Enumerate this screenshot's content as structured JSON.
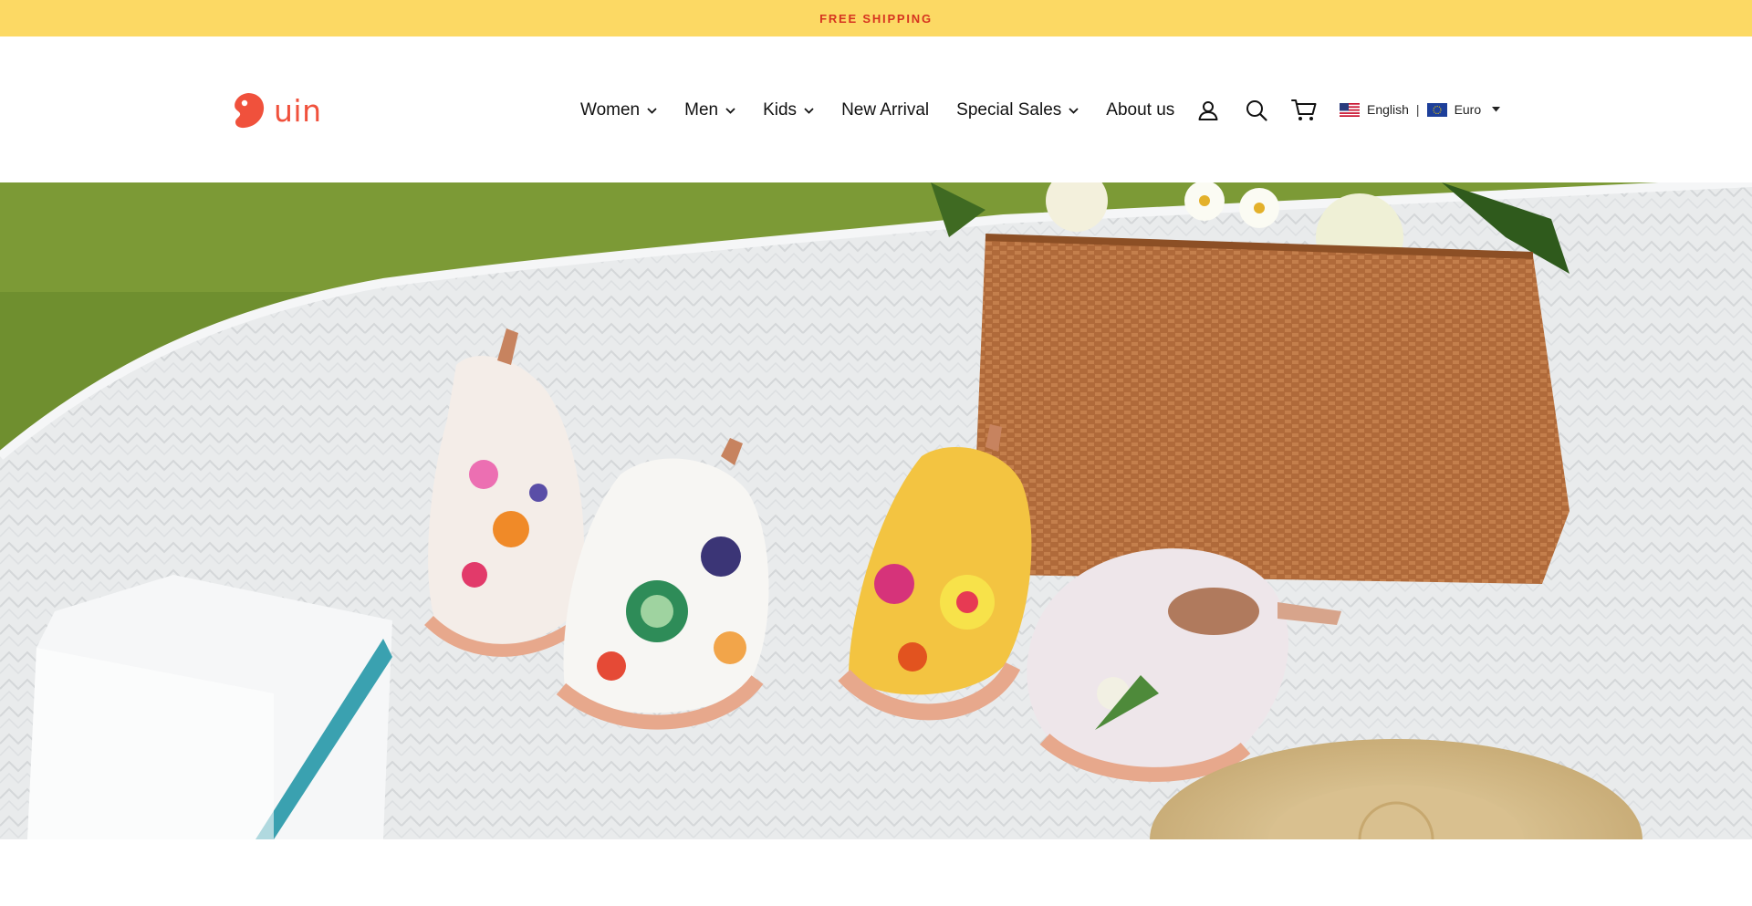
{
  "announcement": {
    "text": "FREE SHIPPING"
  },
  "logo": {
    "text": "uin"
  },
  "nav": {
    "items": [
      {
        "label": "Women",
        "dropdown": true
      },
      {
        "label": "Men",
        "dropdown": true
      },
      {
        "label": "Kids",
        "dropdown": true
      },
      {
        "label": "New Arrival",
        "dropdown": false
      },
      {
        "label": "Special Sales",
        "dropdown": true
      },
      {
        "label": "About us",
        "dropdown": false
      }
    ]
  },
  "header_icons": [
    "account-icon",
    "search-icon",
    "cart-icon"
  ],
  "locale": {
    "language": "English",
    "separator": "|",
    "currency": "Euro"
  },
  "colors": {
    "announcement_bg": "#fcd964",
    "announcement_text": "#d6331f",
    "brand": "#f0513c"
  }
}
